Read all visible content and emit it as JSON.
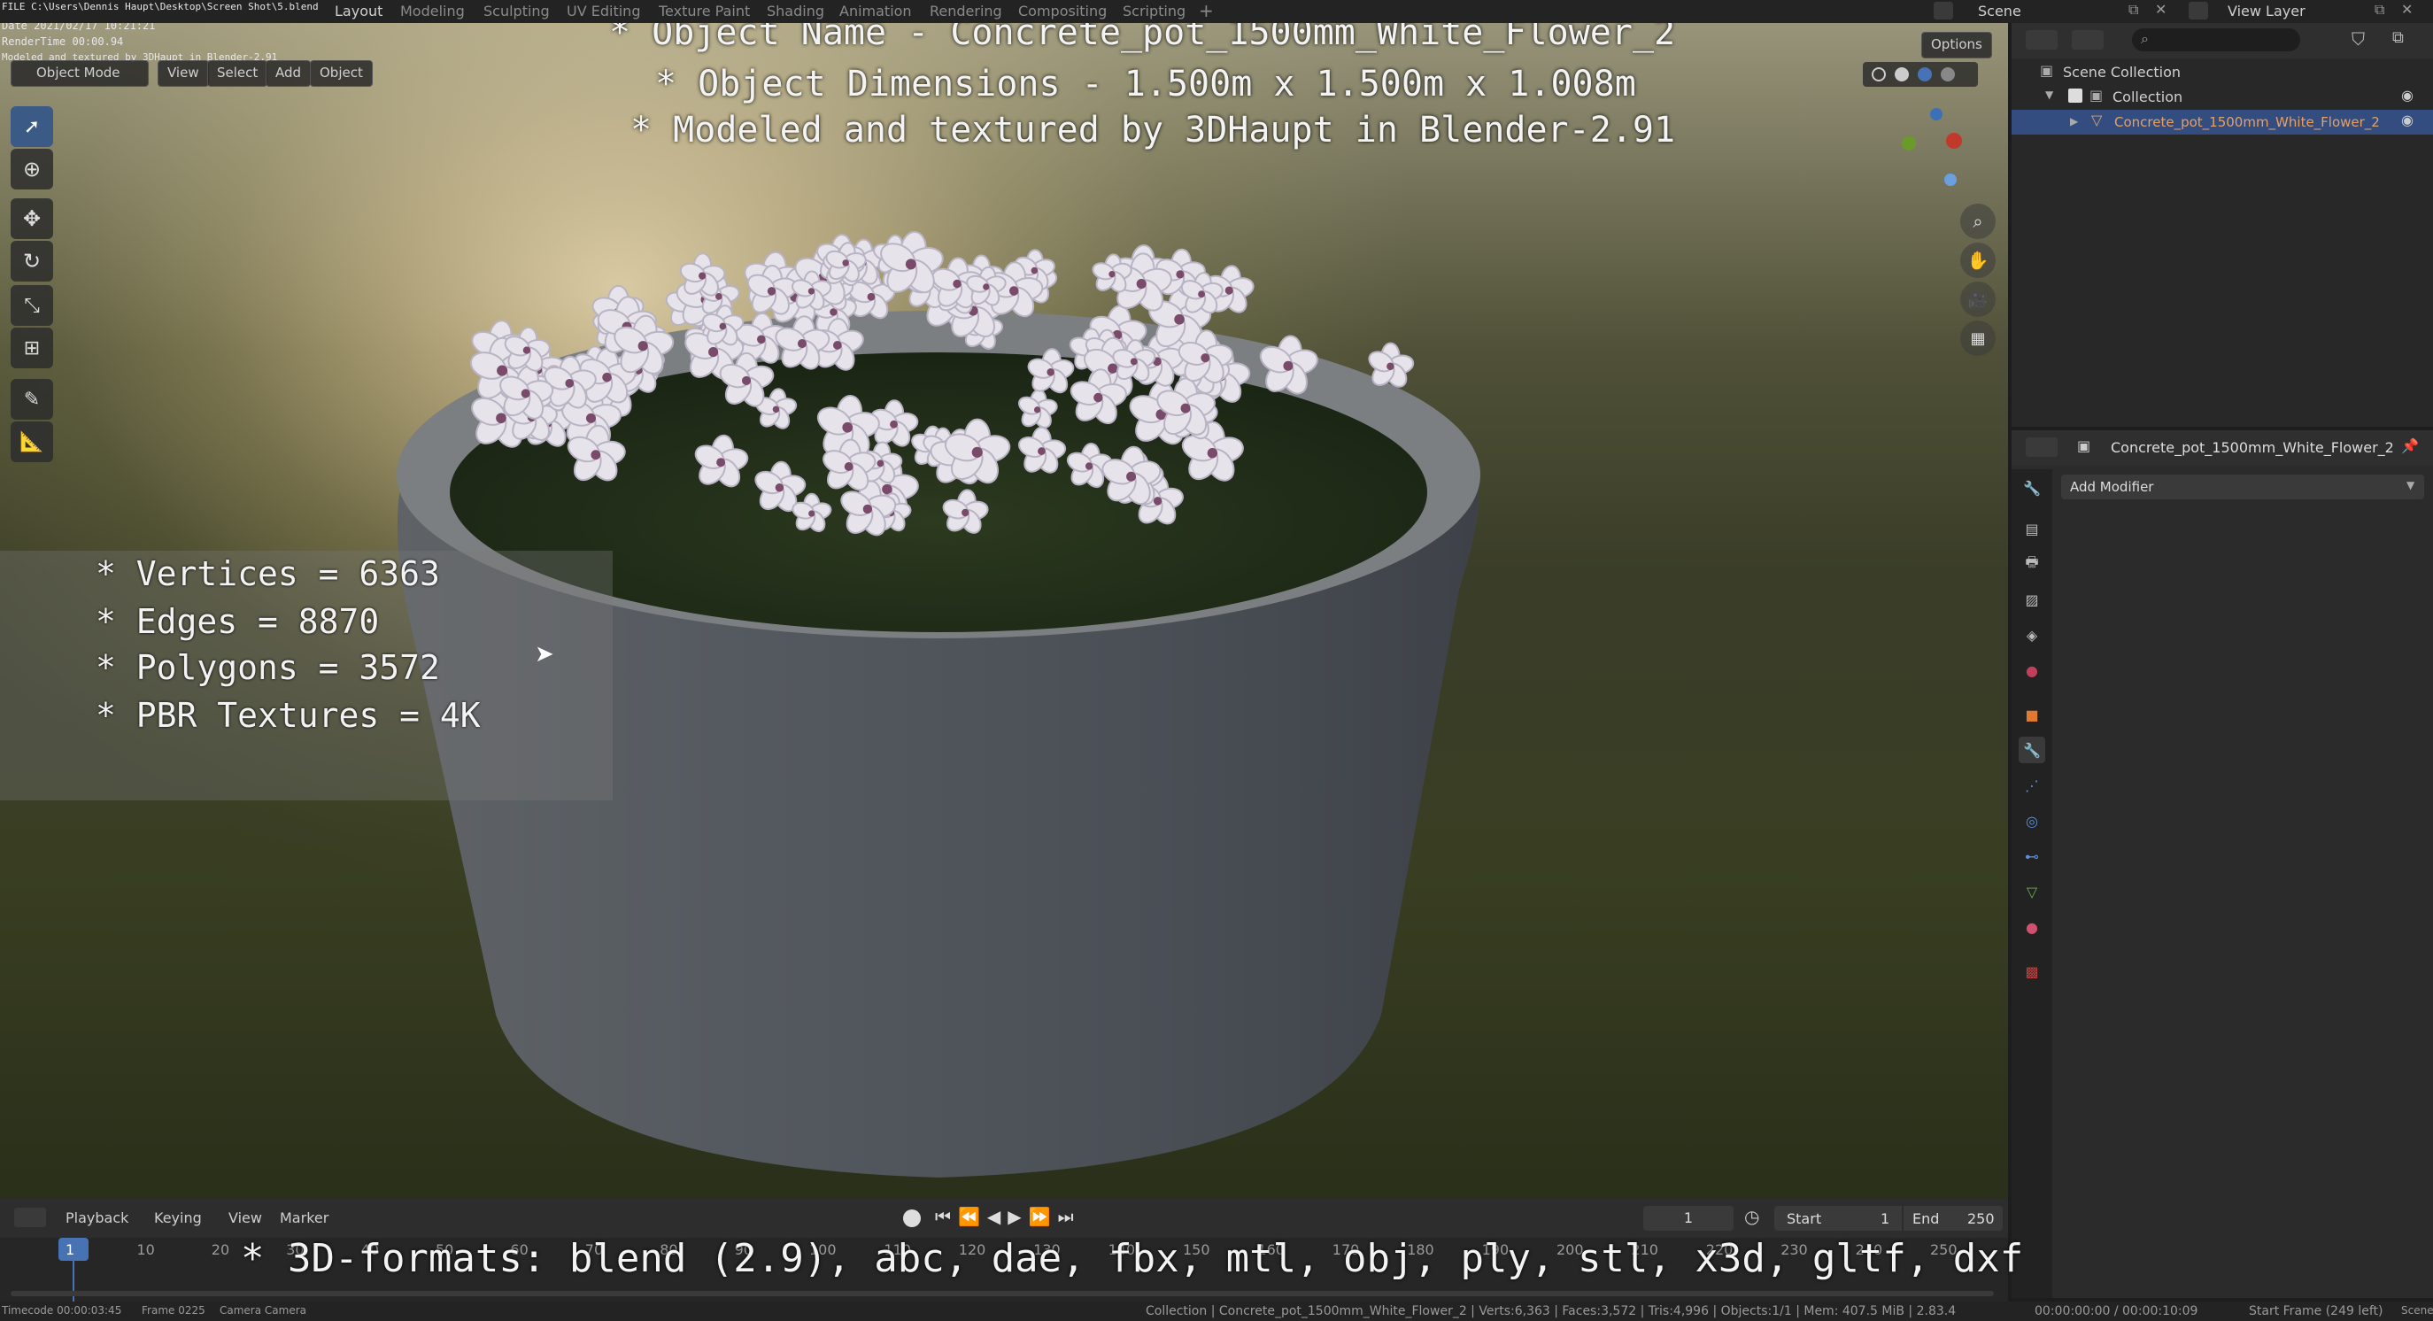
{
  "topbar": {
    "file_path": "FILE C:\\Users\\Dennis Haupt\\Desktop\\Screen Shot\\5.blend",
    "date": "Date 2021/02/17 10:21:21",
    "render_time": "RenderTime 00:00.94",
    "note": "Modeled and textured by 3DHaupt in Blender-2.91",
    "tabs": [
      "Layout",
      "Modeling",
      "Sculpting",
      "UV Editing",
      "Texture Paint",
      "Shading",
      "Animation",
      "Rendering",
      "Compositing",
      "Scripting"
    ],
    "active_tab": "Layout",
    "scene_label": "Scene",
    "view_layer_label": "View Layer"
  },
  "viewport": {
    "mode": "Object Mode",
    "menu": [
      "View",
      "Select",
      "Add",
      "Object"
    ],
    "options_label": "Options",
    "title_lines": [
      "* Object Name - Concrete_pot_1500mm_White_Flower_2",
      "* Object Dimensions -  1.500m x 1.500m x 1.008m",
      "* Modeled and textured by 3DHaupt in Blender-2.91"
    ],
    "stats": [
      "* Vertices = 6363",
      "* Edges = 8870",
      "* Polygons = 3572",
      "* PBR Textures = 4K"
    ]
  },
  "outliner": {
    "scene_collection": "Scene Collection",
    "collection": "Collection",
    "object": "Concrete_pot_1500mm_White_Flower_2"
  },
  "properties": {
    "object_name": "Concrete_pot_1500mm_White_Flower_2",
    "add_modifier": "Add Modifier"
  },
  "timeline": {
    "menu": [
      "Playback",
      "Keying",
      "View",
      "Marker"
    ],
    "current_frame": "1",
    "start_label": "Start",
    "start_value": "1",
    "end_label": "End",
    "end_value": "250",
    "ticks": [
      "1",
      "10",
      "20",
      "30",
      "40",
      "50",
      "60",
      "70",
      "80",
      "90",
      "100",
      "110",
      "120",
      "130",
      "140",
      "150",
      "160",
      "170",
      "180",
      "190",
      "200",
      "210",
      "220",
      "230",
      "240",
      "250"
    ],
    "formats_line": "* 3D-formats: blend (2.9), abc, dae, fbx, mtl, obj, ply, stl, x3d, gltf, dxf"
  },
  "statusbar": {
    "timecode": "Timecode 00:00:03:45",
    "frame": "Frame 0225",
    "camera": "Camera Camera",
    "info": "Collection | Concrete_pot_1500mm_White_Flower_2 | Verts:6,363 | Faces:3,572 | Tris:4,996 | Objects:1/1 | Mem: 407.5 MiB | 2.83.4",
    "time": "00:00:00:00 / 00:00:10:09",
    "start_frame": "Start Frame (249 left)",
    "scene": "Scene"
  },
  "colors": {
    "accent": "#4772b3",
    "selected_row": "#334d80",
    "pot": "#55585d"
  }
}
